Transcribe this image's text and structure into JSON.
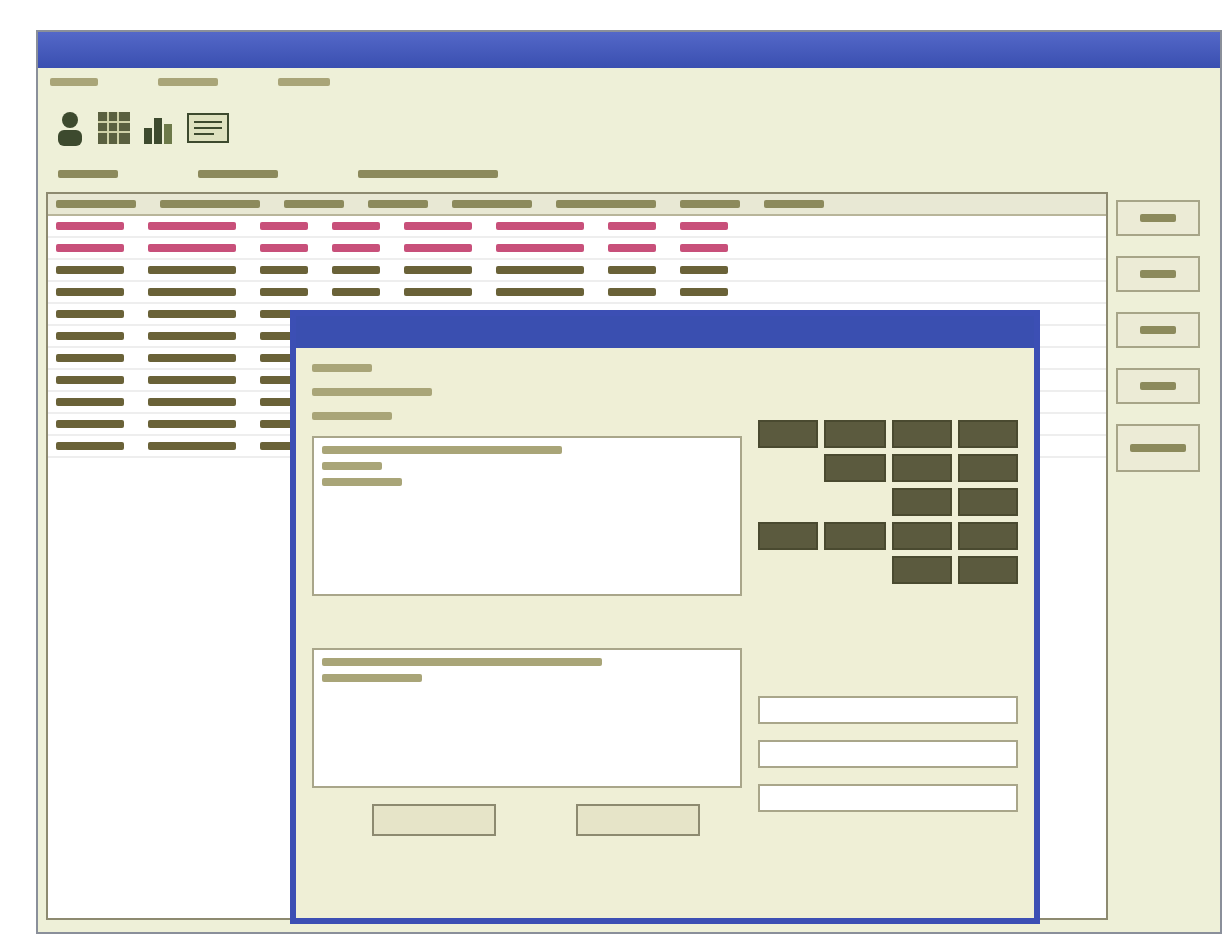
{
  "main_window": {
    "toolbar": [
      {
        "kind": "person"
      },
      {
        "kind": "grid"
      },
      {
        "kind": "chart"
      },
      {
        "kind": "text"
      }
    ],
    "table": {
      "rows": [
        {
          "color": "#c8507a"
        },
        {
          "color": "#c8507a"
        },
        {
          "color": "#6a6238"
        },
        {
          "color": "#6a6238"
        },
        {
          "color": "#6a6238"
        },
        {
          "color": "#6a6238"
        },
        {
          "color": "#6a6238"
        },
        {
          "color": "#6a6238"
        },
        {
          "color": "#6a6238"
        },
        {
          "color": "#6a6238"
        },
        {
          "color": "#6a6238"
        }
      ]
    },
    "side_buttons": [
      {
        "kind": "button"
      },
      {
        "kind": "button"
      },
      {
        "kind": "button"
      },
      {
        "kind": "button"
      },
      {
        "kind": "list"
      }
    ]
  },
  "dialog": {
    "keypad": [
      {
        "kind": "key"
      },
      {
        "kind": "key"
      },
      {
        "kind": "key"
      },
      {
        "kind": "key"
      },
      {
        "kind": "blank"
      },
      {
        "kind": "key"
      },
      {
        "kind": "key"
      },
      {
        "kind": "key"
      },
      {
        "kind": "blank"
      },
      {
        "kind": "blank"
      },
      {
        "kind": "key"
      },
      {
        "kind": "key"
      },
      {
        "kind": "key"
      },
      {
        "kind": "key"
      },
      {
        "kind": "key"
      },
      {
        "kind": "key"
      },
      {
        "kind": "blank"
      },
      {
        "kind": "blank"
      },
      {
        "kind": "key"
      },
      {
        "kind": "key"
      }
    ],
    "buttons": [
      {
        "kind": "button"
      },
      {
        "kind": "button"
      }
    ]
  }
}
